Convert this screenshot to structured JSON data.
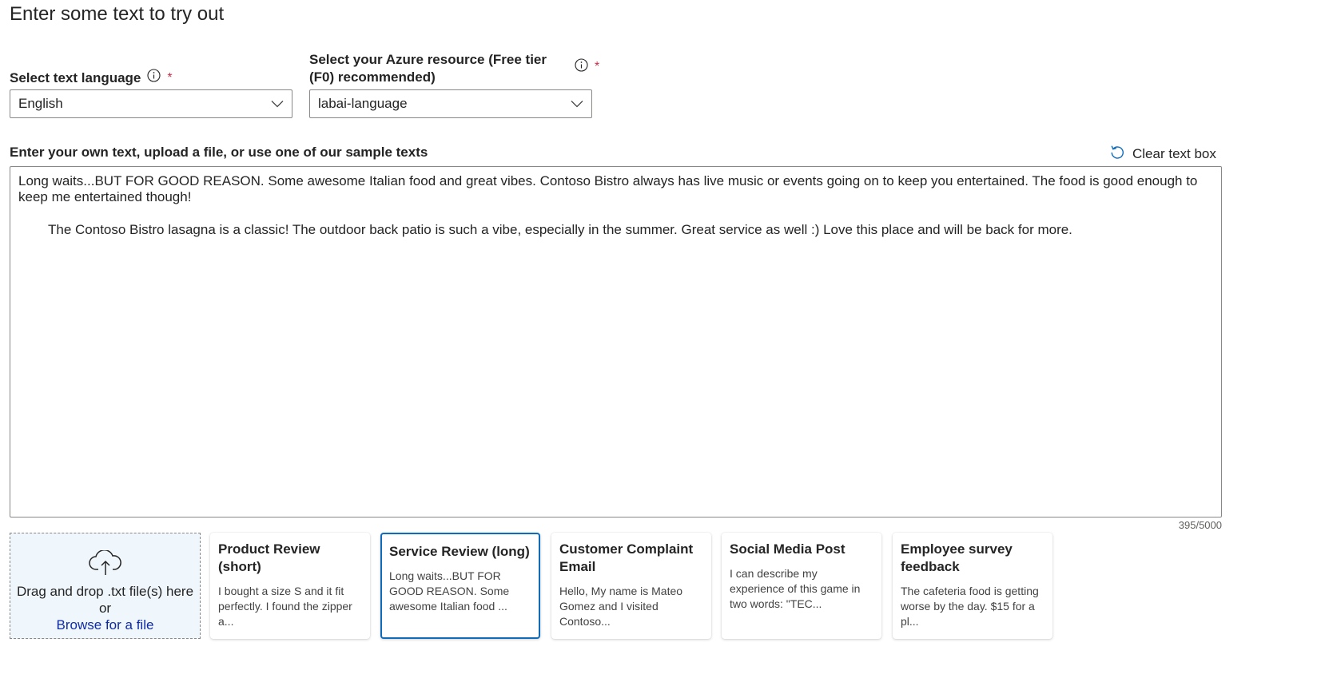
{
  "page": {
    "title": "Enter some text to try out"
  },
  "language": {
    "label": "Select text language",
    "required_mark": "*",
    "value": "English"
  },
  "resource": {
    "label": "Select your Azure resource (Free tier (F0) recommended)",
    "required_mark": "*",
    "value": "labai-language"
  },
  "text_input": {
    "label": "Enter your own text, upload a file, or use one of our sample texts",
    "clear_label": "Clear text box",
    "paragraph1": "Long waits...BUT FOR GOOD REASON. Some awesome Italian food and great vibes. Contoso Bistro always has live music or events going on to keep you entertained. The food is good enough to keep me entertained though!",
    "paragraph2": "The Contoso Bistro lasagna is a classic! The outdoor back patio is such a vibe, especially in the summer. Great service as well :) Love this place and will be back for more.",
    "char_count": "395/5000"
  },
  "upload": {
    "drag_text": "Drag and drop .txt file(s) here",
    "or_text": "or",
    "browse_label": "Browse for a file"
  },
  "samples": [
    {
      "title": "Product Review (short)",
      "preview": "I bought a size S and it fit perfectly. I found the zipper a..."
    },
    {
      "title": "Service Review (long)",
      "preview": "Long waits...BUT FOR GOOD REASON. Some awesome Italian food ..."
    },
    {
      "title": "Customer Complaint Email",
      "preview": "Hello, My name is Mateo Gomez and I visited Contoso..."
    },
    {
      "title": "Social Media Post",
      "preview": "I can describe my experience of this game in two words: \"TEC..."
    },
    {
      "title": "Employee survey feedback",
      "preview": "The cafeteria food is getting worse by the day. $15 for a pl..."
    }
  ],
  "colors": {
    "accent": "#0f6cbd",
    "link": "#0f2ba6",
    "required": "#c4314b",
    "dropzone_bg": "#eff6fc"
  },
  "icons": {
    "info": "info-icon",
    "chevron": "chevron-down-icon",
    "reset": "reset-icon",
    "upload": "cloud-upload-icon"
  }
}
